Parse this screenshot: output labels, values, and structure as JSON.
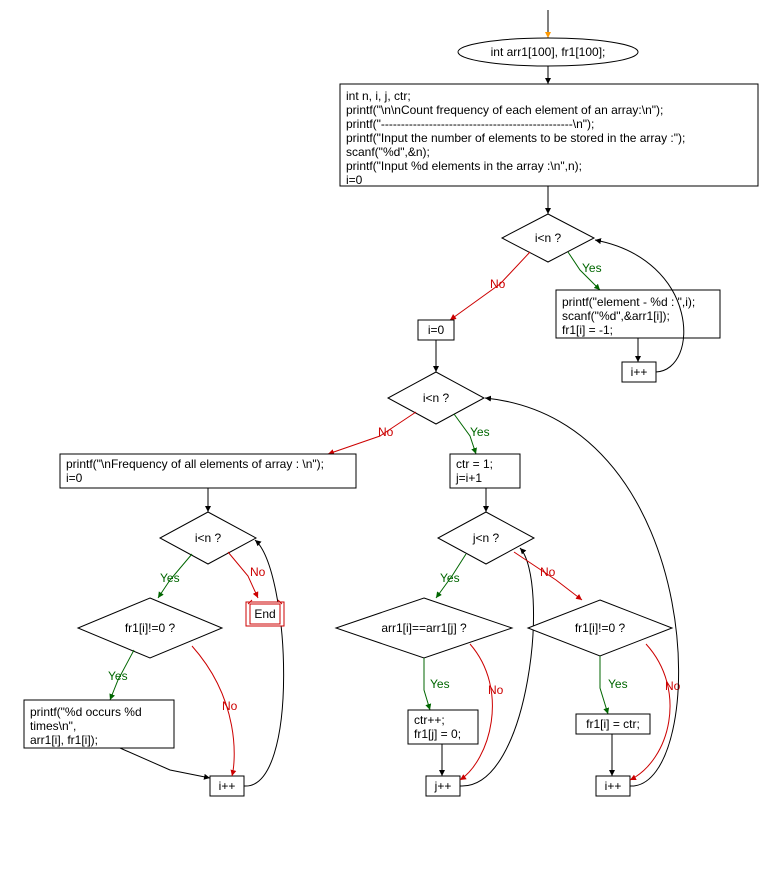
{
  "chart_data": {
    "type": "flowchart",
    "title": "",
    "nodes": {
      "decl": "int arr1[100], fr1[100];",
      "init_lines": [
        "int n, i, j, ctr;",
        "printf(\"\\n\\nCount frequency of each element of an array:\\n\");",
        "printf(\"------------------------------------------------\\n\");",
        "printf(\"Input the number of elements to be stored in the array :\");",
        "scanf(\"%d\",&n);",
        "printf(\"Input %d elements in the array :\\n\",n);",
        "i=0"
      ],
      "cond1": "i<n ?",
      "read_lines": [
        "printf(\"element - %d : \",i);",
        "scanf(\"%d\",&arr1[i]);",
        "fr1[i] = -1;"
      ],
      "inc1": "i++",
      "reset_i": "i=0",
      "cond2": "i<n ?",
      "set_ctr_lines": [
        "ctr = 1;",
        "j=i+1"
      ],
      "cond_j": "j<n ?",
      "cond_eq": "arr1[i]==arr1[j] ?",
      "eq_body_lines": [
        "ctr++;",
        "fr1[j] = 0;"
      ],
      "inc_j": "j++",
      "cond_fr1": "fr1[i]!=0 ?",
      "set_fr1": "fr1[i] = ctr;",
      "inc2": "i++",
      "print_freq_lines": [
        "printf(\"\\nFrequency of all elements of array : \\n\");",
        "i=0"
      ],
      "cond3": "i<n ?",
      "cond_fr2": "fr1[i]!=0 ?",
      "print_occ_lines": [
        "printf(\"%d occurs %d",
        "times\\n\",",
        "arr1[i], fr1[i]);"
      ],
      "inc3": "i++",
      "end": "End"
    },
    "labels": {
      "yes": "Yes",
      "no": "No"
    }
  }
}
